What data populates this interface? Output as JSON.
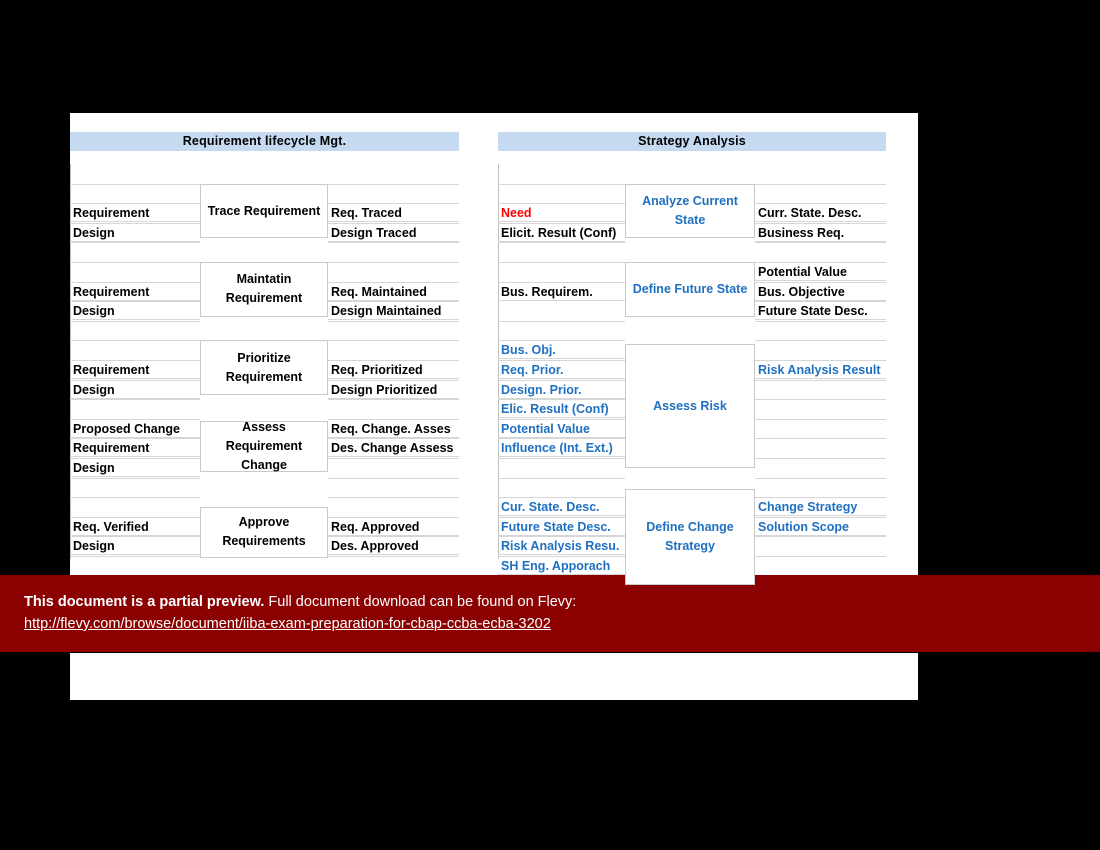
{
  "banner": {
    "bold_text": "This document is a partial preview.",
    "rest_text": " Full document download can be found on Flevy:",
    "url": "http://flevy.com/browse/document/iiba-exam-preparation-for-cbap-ccba-ecba-3202"
  },
  "panels": [
    {
      "title": "Requirement lifecycle Mgt.",
      "groups": [
        {
          "process": "Trace Requirement",
          "inputs": [
            "Requirement",
            "Design"
          ],
          "outputs": [
            "Req. Traced",
            "Design Traced"
          ]
        },
        {
          "process": "Maintatin Requirement",
          "inputs": [
            "Requirement",
            "Design"
          ],
          "outputs": [
            "Req. Maintained",
            "Design Maintained"
          ]
        },
        {
          "process": "Prioritize Requirement",
          "inputs": [
            "Requirement",
            "Design"
          ],
          "outputs": [
            "Req. Prioritized",
            "Design Prioritized"
          ]
        },
        {
          "process": "Assess Requirement Change",
          "inputs": [
            "Proposed Change",
            "Requirement",
            "Design"
          ],
          "outputs": [
            "Req. Change. Asses",
            "Des. Change Assess"
          ]
        },
        {
          "process": "Approve Requirements",
          "inputs": [
            "Req. Verified",
            "Design"
          ],
          "outputs": [
            "Req. Approved",
            "Des. Approved"
          ]
        }
      ]
    },
    {
      "title": "Strategy Analysis",
      "groups": [
        {
          "process": "Analyze Current State",
          "inputs": [
            "Need",
            "Elicit. Result (Conf)"
          ],
          "outputs": [
            "Curr. State. Desc.",
            "Business Req."
          ]
        },
        {
          "process": "Define Future State",
          "inputs": [
            "Bus. Requirem."
          ],
          "outputs": [
            "Potential Value",
            "Bus. Objective",
            "Future State Desc."
          ]
        },
        {
          "process": "Assess Risk",
          "inputs": [
            "Bus. Obj.",
            "Req. Prior.",
            "Design. Prior.",
            "Elic. Result (Conf)",
            "Potential Value",
            "Influence (Int. Ext.)"
          ],
          "outputs": [
            "Risk Analysis Result"
          ]
        },
        {
          "process": "Define Change Strategy",
          "inputs": [
            "Cur. State. Desc.",
            "Future State Desc.",
            "Risk Analysis Resu.",
            "SH Eng. Apporach"
          ],
          "outputs": [
            "Change Strategy",
            "Solution Scope"
          ]
        }
      ]
    }
  ],
  "colors": {
    "header_bg": "#c5d9f1",
    "blue_text": "#1f70c1",
    "red_text": "#ff0000",
    "banner_bg": "#8b0000",
    "rule": "#d6d6d6"
  }
}
